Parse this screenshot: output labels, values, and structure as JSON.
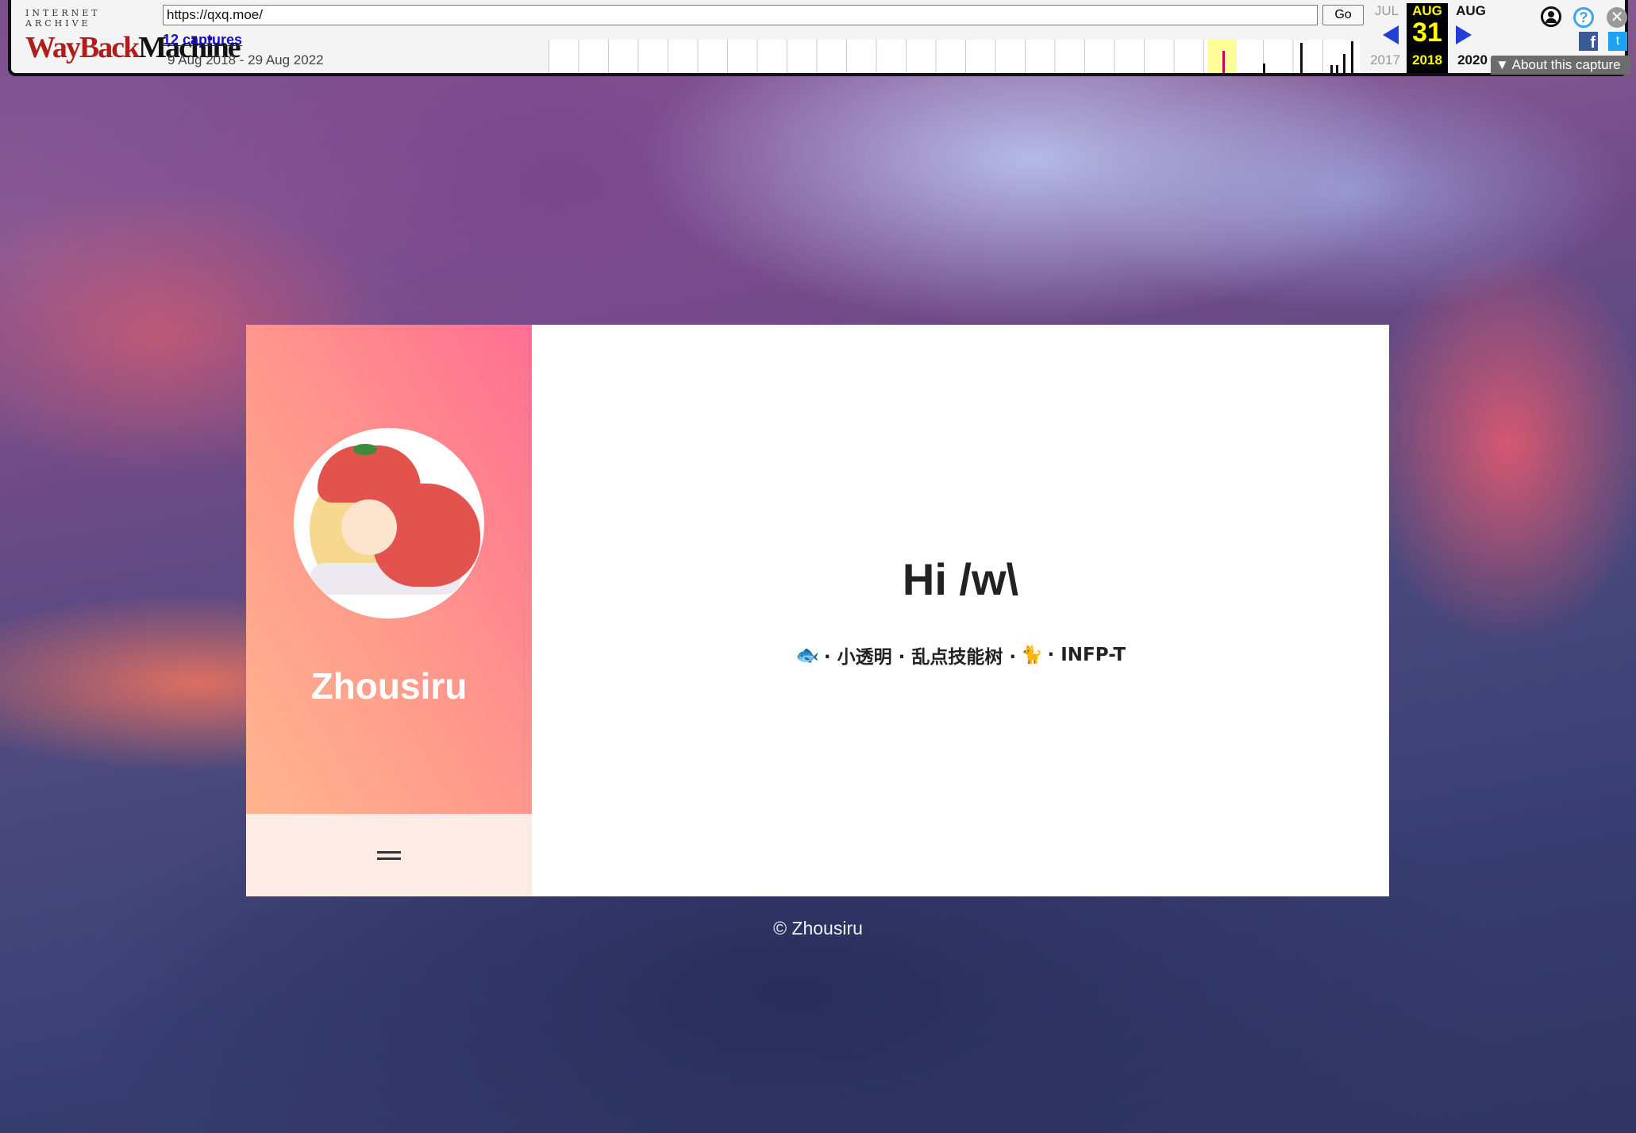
{
  "wayback": {
    "logo_top": "INTERNET ARCHIVE",
    "logo_wayback": "WayBack",
    "logo_machine": "Machine",
    "url": "https://qxq.moe/",
    "go_label": "Go",
    "captures_label": "12 captures",
    "date_range": "9 Aug 2018 - 29 Aug 2022",
    "prev_month": "JUL",
    "cur_month": "AUG",
    "next_month": "AUG",
    "cur_day": "31",
    "prev_year": "2017",
    "cur_year": "2018",
    "next_year": "2020",
    "help_glyph": "?",
    "close_glyph": "✕",
    "facebook_glyph": "f",
    "twitter_glyph": "t",
    "about_label": "▼ About this capture",
    "icons": [
      "user-icon",
      "help-icon",
      "close-icon",
      "facebook-icon",
      "twitter-icon"
    ]
  },
  "profile": {
    "name": "Zhousiru",
    "avatar_alt": "anime avatar"
  },
  "main": {
    "greeting": "Hi /w\\",
    "tagline_fish": "🐟",
    "tagline_part1": "· 小透明 · 乱点技能树 ·",
    "tagline_cat": "🐈",
    "tagline_part2": "· INFP-T"
  },
  "footer": {
    "text": "© Zhousiru"
  },
  "colors": {
    "sidebar_gradient_start": "#ffb48e",
    "sidebar_gradient_end": "#ff6f92",
    "sidebar_bottom": "#fdebe6",
    "wayback_red": "#b01d1d",
    "wayback_blue": "#1f3fd6"
  }
}
